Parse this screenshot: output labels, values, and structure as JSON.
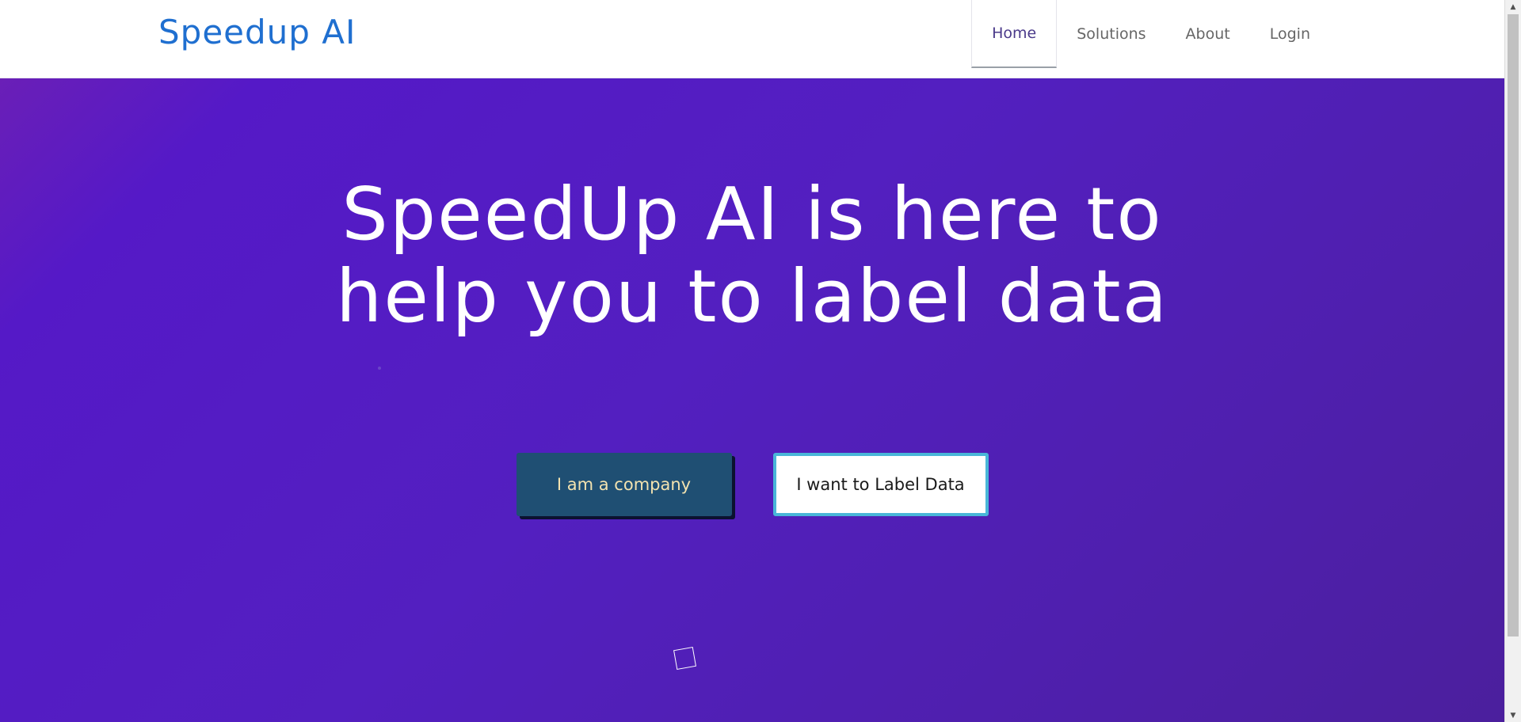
{
  "header": {
    "brand": "Speedup AI",
    "nav": [
      {
        "label": "Home",
        "active": true
      },
      {
        "label": "Solutions",
        "active": false
      },
      {
        "label": "About",
        "active": false
      },
      {
        "label": "Login",
        "active": false
      }
    ]
  },
  "hero": {
    "headline_line1": "SpeedUp AI is here to",
    "headline_line2": "help you to label data",
    "buttons": {
      "company": "I am a company",
      "labeler": "I want to Label Data"
    }
  },
  "colors": {
    "brand": "#1f6fd0",
    "hero_gradient_start": "#6a1fb7",
    "hero_gradient_end": "#4b1f9d",
    "company_button_bg": "#1f4f73",
    "company_button_text": "#f3e3b0",
    "label_button_border": "#49b6d8"
  },
  "icons": {
    "scroll_up": "scroll-up-arrow-icon",
    "scroll_down": "scroll-down-arrow-icon",
    "decorative_square": "square-outline-icon"
  }
}
